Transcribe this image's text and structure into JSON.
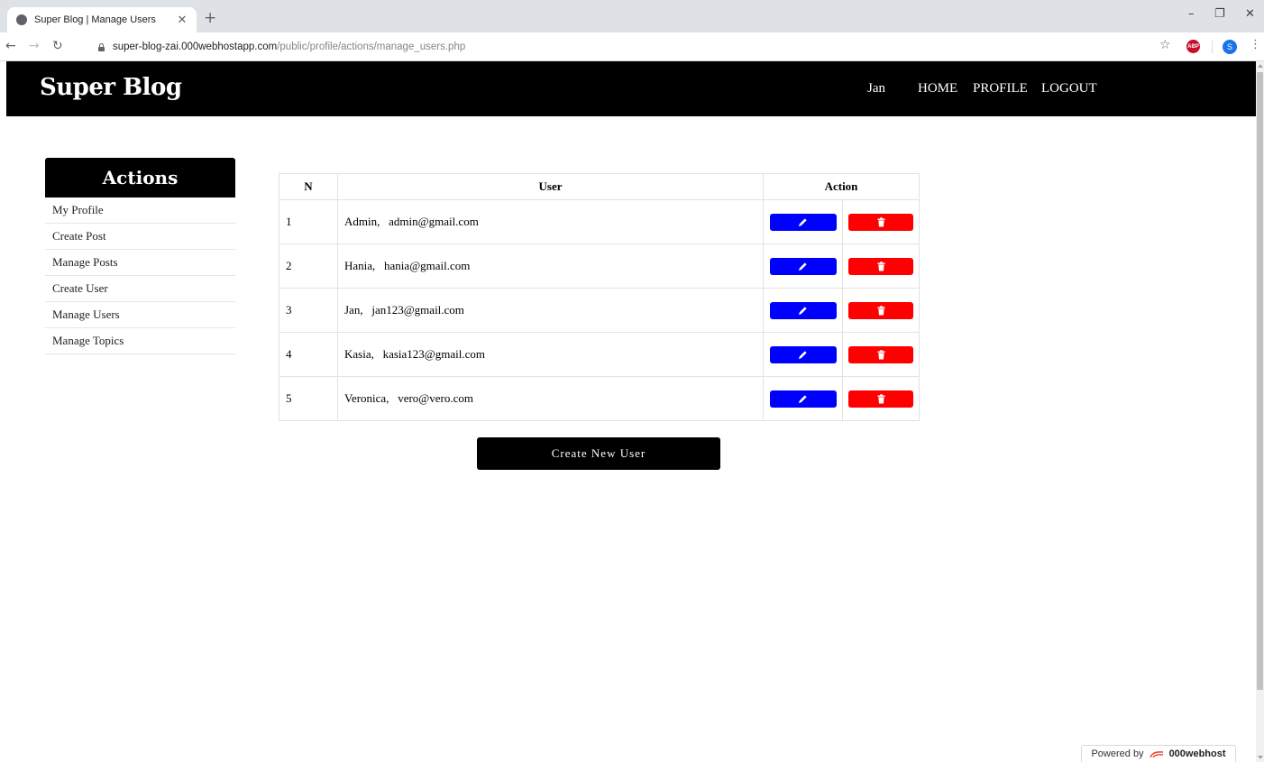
{
  "browser": {
    "tab_title": "Super Blog | Manage Users",
    "url_host": "super-blog-zai.000webhostapp.com",
    "url_path": "/public/profile/actions/manage_users.php",
    "profile_initial": "S",
    "abp_label": "ABP"
  },
  "header": {
    "logo": "Super Blog",
    "username": "Jan",
    "nav": [
      "HOME",
      "PROFILE",
      "LOGOUT"
    ]
  },
  "sidebar": {
    "title": "Actions",
    "items": [
      "My Profile",
      "Create Post",
      "Manage Posts",
      "Create User",
      "Manage Users",
      "Manage Topics"
    ]
  },
  "table": {
    "headers": {
      "n": "N",
      "user": "User",
      "action": "Action"
    },
    "rows": [
      {
        "n": "1",
        "user": "Admin,   admin@gmail.com"
      },
      {
        "n": "2",
        "user": "Hania,   hania@gmail.com"
      },
      {
        "n": "3",
        "user": "Jan,   jan123@gmail.com"
      },
      {
        "n": "4",
        "user": "Kasia,   kasia123@gmail.com"
      },
      {
        "n": "5",
        "user": "Veronica,   vero@vero.com"
      }
    ]
  },
  "create_button": "Create New User",
  "footer": {
    "powered_by": "Powered by",
    "brand": "000webhost"
  },
  "colors": {
    "edit": "#0000ff",
    "delete": "#ff0000",
    "header_bg": "#000000"
  },
  "icons": {
    "edit": "pencil-icon",
    "delete": "trash-icon"
  }
}
